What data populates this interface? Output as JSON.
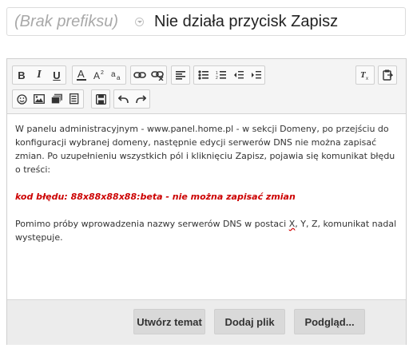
{
  "title_row": {
    "prefix": "(Brak prefiksu)",
    "title": "Nie działa przycisk Zapisz"
  },
  "toolbar": {
    "row1": [
      {
        "icon": "bold-icon",
        "glyph": "B"
      },
      {
        "icon": "italic-icon",
        "glyph": "I"
      },
      {
        "icon": "underline-icon",
        "glyph": "U"
      },
      {
        "icon": "text-color-icon",
        "glyph": "A"
      },
      {
        "icon": "superscript-icon",
        "glyph": "A²"
      },
      {
        "icon": "subscript-icon",
        "glyph": "ᵃa"
      },
      {
        "icon": "link-icon"
      },
      {
        "icon": "unlink-icon"
      },
      {
        "icon": "align-left-icon"
      },
      {
        "icon": "bulleted-list-icon"
      },
      {
        "icon": "numbered-list-icon"
      },
      {
        "icon": "outdent-icon"
      },
      {
        "icon": "indent-icon"
      },
      {
        "icon": "remove-format-icon",
        "glyph": "Tx"
      },
      {
        "icon": "paste-icon"
      }
    ],
    "row2": [
      {
        "icon": "smiley-icon"
      },
      {
        "icon": "image-icon"
      },
      {
        "icon": "gallery-icon"
      },
      {
        "icon": "template-icon"
      },
      {
        "icon": "save-icon"
      },
      {
        "icon": "undo-icon"
      },
      {
        "icon": "redo-icon"
      }
    ]
  },
  "body": {
    "p1": "W panelu administracyjnym - www.panel.home.pl - w sekcji Domeny, po przejściu do konfiguracji wybranej domeny, następnie edycji serwerów DNS nie można zapisać zmian. Po uzupełnieniu wszystkich pól i kliknięciu Zapisz, pojawia się komunikat błędu o treści:",
    "error": "kod błędu: 88x88x88x88:beta - nie można zapisać zmian",
    "p3_before": "Pomimo próby wprowadzenia nazwy serwerów DNS w postaci ",
    "p3_spell": "X",
    "p3_after": ", Y, Z, komunikat nadal występuje."
  },
  "footer": {
    "create_topic": "Utwórz temat",
    "add_file": "Dodaj plik",
    "preview": "Podgląd..."
  },
  "colors": {
    "error_text": "#cc0000",
    "prefix_text": "#a9a9a9",
    "toolbar_bg": "#f4f4f4",
    "footer_bg": "#ececec",
    "button_bg": "#d9d9d9"
  }
}
